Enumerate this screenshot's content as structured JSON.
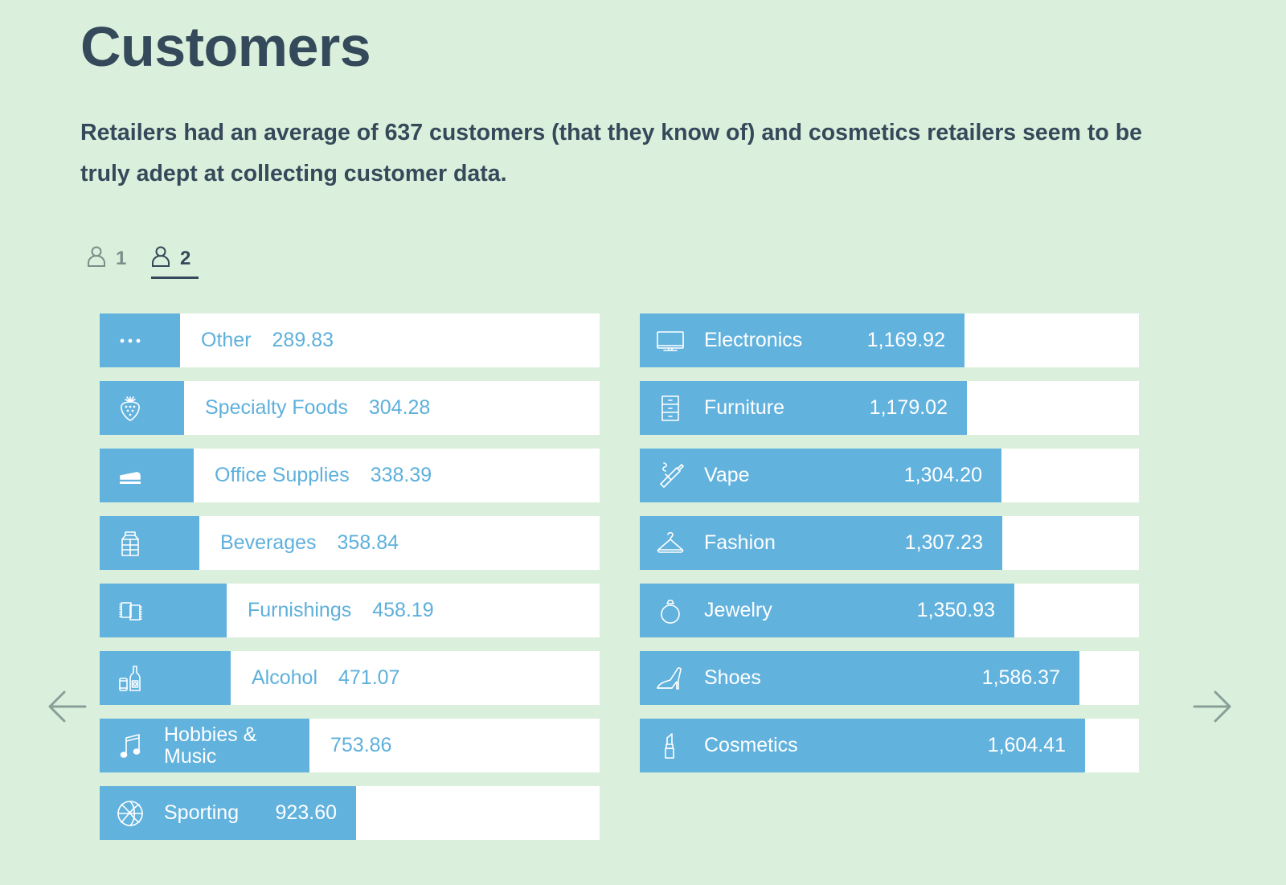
{
  "header": {
    "title": "Customers",
    "description": "Retailers had an average of 637 customers (that they know of) and cosmetics retailers seem to be truly adept at collecting customer data."
  },
  "tabs": [
    {
      "label": "1",
      "icon": "person-icon",
      "active": false
    },
    {
      "label": "2",
      "icon": "person-icon",
      "active": true
    }
  ],
  "nav": {
    "prev_icon": "arrow-left-icon",
    "next_icon": "arrow-right-icon"
  },
  "colors": {
    "background": "#dbf0dc",
    "bar": "#62b2de",
    "track": "#ffffff",
    "value_text": "#5eb0dc",
    "heading": "#34495a"
  },
  "chart_data": {
    "type": "bar",
    "orientation": "horizontal",
    "title": "Customers",
    "xlim": [
      0,
      1800
    ],
    "columns": [
      {
        "items": [
          {
            "category": "Other",
            "value": 289.83,
            "display": "289.83",
            "icon": "dots-icon"
          },
          {
            "category": "Specialty Foods",
            "value": 304.28,
            "display": "304.28",
            "icon": "strawberry-icon"
          },
          {
            "category": "Office Supplies",
            "value": 338.39,
            "display": "338.39",
            "icon": "stapler-icon"
          },
          {
            "category": "Beverages",
            "value": 358.84,
            "display": "358.84",
            "icon": "milk-carton-icon"
          },
          {
            "category": "Furnishings",
            "value": 458.19,
            "display": "458.19",
            "icon": "rug-icon"
          },
          {
            "category": "Alcohol",
            "value": 471.07,
            "display": "471.07",
            "icon": "bottle-can-icon"
          },
          {
            "category": "Hobbies & Music",
            "value": 753.86,
            "display": "753.86",
            "icon": "music-note-icon"
          },
          {
            "category": "Sporting",
            "value": 923.6,
            "display": "923.60",
            "icon": "basketball-icon"
          }
        ]
      },
      {
        "items": [
          {
            "category": "Electronics",
            "value": 1169.92,
            "display": "1,169.92",
            "icon": "tv-icon"
          },
          {
            "category": "Furniture",
            "value": 1179.02,
            "display": "1,179.02",
            "icon": "cabinet-icon"
          },
          {
            "category": "Vape",
            "value": 1304.2,
            "display": "1,304.20",
            "icon": "vape-icon"
          },
          {
            "category": "Fashion",
            "value": 1307.23,
            "display": "1,307.23",
            "icon": "hanger-icon"
          },
          {
            "category": "Jewelry",
            "value": 1350.93,
            "display": "1,350.93",
            "icon": "ring-icon"
          },
          {
            "category": "Shoes",
            "value": 1586.37,
            "display": "1,586.37",
            "icon": "high-heel-icon"
          },
          {
            "category": "Cosmetics",
            "value": 1604.41,
            "display": "1,604.41",
            "icon": "lipstick-icon"
          }
        ]
      }
    ]
  }
}
